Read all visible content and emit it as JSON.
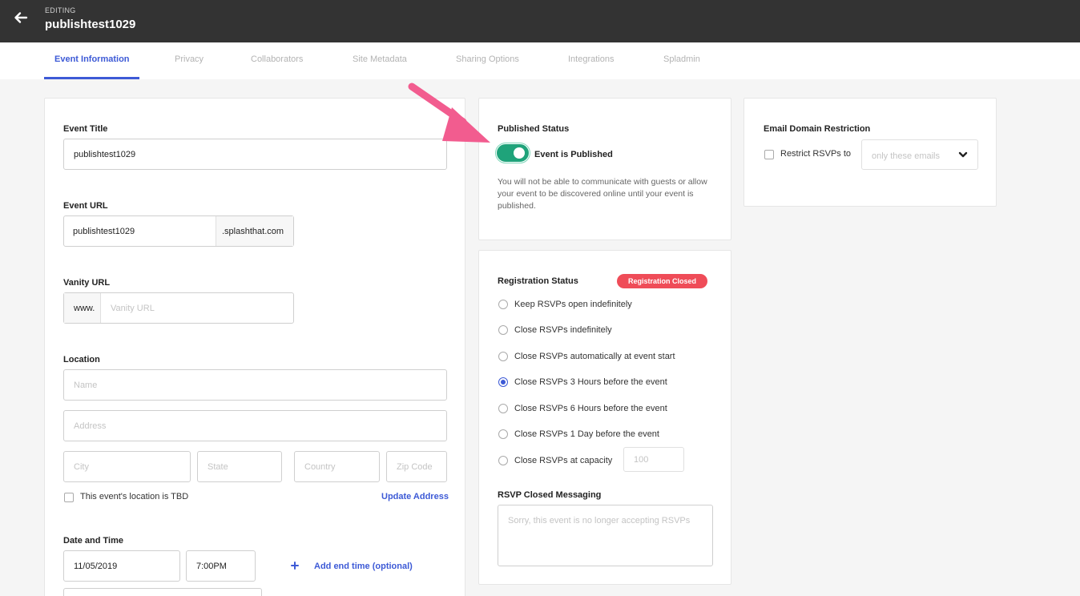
{
  "header": {
    "editing_label": "EDITING",
    "event_name": "publishtest1029"
  },
  "tabs": [
    {
      "label": "Event Information",
      "active": true
    },
    {
      "label": "Privacy"
    },
    {
      "label": "Collaborators"
    },
    {
      "label": "Site Metadata"
    },
    {
      "label": "Sharing Options"
    },
    {
      "label": "Integrations"
    },
    {
      "label": "Spladmin"
    }
  ],
  "event_info": {
    "title_label": "Event Title",
    "title_value": "publishtest1029",
    "url_label": "Event URL",
    "url_value": "publishtest1029",
    "url_suffix": ".splashthat.com",
    "vanity_label": "Vanity URL",
    "vanity_prefix": "www.",
    "vanity_placeholder": "Vanity URL",
    "location_label": "Location",
    "location_name_placeholder": "Name",
    "location_address_placeholder": "Address",
    "city_placeholder": "City",
    "state_placeholder": "State",
    "country_placeholder": "Country",
    "zip_placeholder": "Zip Code",
    "tbd_label": "This event's location is TBD",
    "update_address": "Update Address",
    "datetime_label": "Date and Time",
    "date_value": "11/05/2019",
    "time_value": "7:00PM",
    "add_end_time": "Add end time (optional)"
  },
  "published": {
    "title": "Published Status",
    "toggle_label": "Event is Published",
    "is_published": true,
    "description": "You will not be able to communicate with guests or allow your event to be discovered online until your event is published."
  },
  "registration": {
    "title": "Registration Status",
    "badge": "Registration Closed",
    "options": [
      {
        "label": "Keep RSVPs open indefinitely",
        "selected": false
      },
      {
        "label": "Close RSVPs indefinitely",
        "selected": false
      },
      {
        "label": "Close RSVPs automatically at event start",
        "selected": false
      },
      {
        "label": "Close RSVPs 3 Hours before the event",
        "selected": true
      },
      {
        "label": "Close RSVPs 6 Hours before the event",
        "selected": false
      },
      {
        "label": "Close RSVPs 1 Day before the event",
        "selected": false
      },
      {
        "label": "Close RSVPs at capacity",
        "selected": false
      }
    ],
    "capacity_placeholder": "100",
    "closed_messaging_label": "RSVP Closed Messaging",
    "closed_messaging_placeholder": "Sorry, this event is no longer accepting RSVPs"
  },
  "email_domain": {
    "title": "Email Domain Restriction",
    "checkbox_label": "Restrict RSVPs to",
    "select_value": "only these emails"
  },
  "colors": {
    "accent": "#3d5ad6",
    "toggle_on": "#1fa37a",
    "badge": "#ef4c58",
    "arrow": "#f25c8f"
  }
}
